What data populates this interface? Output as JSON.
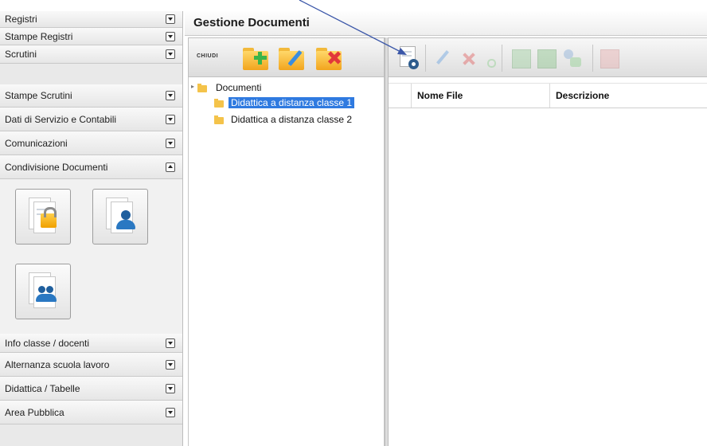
{
  "sidebar": {
    "sections": [
      {
        "label": "Registri",
        "expanded": false
      },
      {
        "label": "Stampe Registri",
        "expanded": false
      },
      {
        "label": "Scrutini",
        "expanded": false
      },
      {
        "label": "Stampe Scrutini",
        "expanded": false
      },
      {
        "label": "Dati di Servizio e Contabili",
        "expanded": false
      },
      {
        "label": "Comunicazioni",
        "expanded": false
      },
      {
        "label": "Condivisione Documenti",
        "expanded": true
      },
      {
        "label": "Info classe / docenti",
        "expanded": false
      },
      {
        "label": "Alternanza scuola lavoro",
        "expanded": false
      },
      {
        "label": "Didattica / Tabelle",
        "expanded": false
      },
      {
        "label": "Area Pubblica",
        "expanded": false
      }
    ],
    "condivisione_icons": [
      "locked-document-icon",
      "user-document-icon",
      "group-document-icon"
    ]
  },
  "main": {
    "title": "Gestione Documenti",
    "tree_toolbar": {
      "close_label": "CHIUDI",
      "buttons": [
        "add-folder-icon",
        "edit-folder-icon",
        "delete-folder-icon"
      ]
    },
    "tree": {
      "root": "Documenti",
      "children": [
        {
          "label": "Didattica a distanza classe 1",
          "selected": true
        },
        {
          "label": "Didattica a distanza classe 2",
          "selected": false
        }
      ]
    },
    "file_toolbar": {
      "buttons": [
        "add-document-icon",
        "edit-icon",
        "delete-icon",
        "circle-icon",
        "export-icon",
        "grid-icon",
        "share-icon",
        "remove-icon"
      ]
    },
    "grid": {
      "columns": [
        "",
        "Nome File",
        "Descrizione"
      ]
    }
  },
  "colors": {
    "selection": "#2f7ae0",
    "folder": "#f4c34a",
    "arrow": "#3a56a8"
  }
}
